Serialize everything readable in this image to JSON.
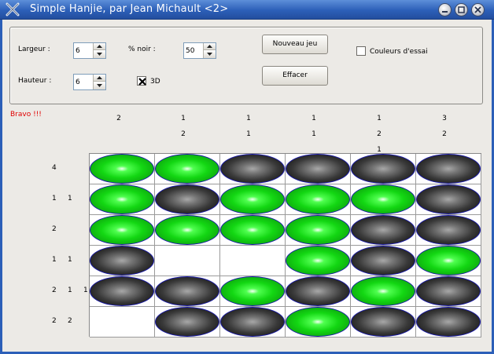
{
  "window": {
    "title": "Simple Hanjie, par Jean Michault <2>"
  },
  "controls": {
    "largeur_label": "Largeur :",
    "largeur_value": "6",
    "hauteur_label": "Hauteur :",
    "hauteur_value": "6",
    "noir_label": "% noir :",
    "noir_value": "50",
    "checkbox_3d_label": "3D",
    "checkbox_3d_checked": true,
    "nouveau_jeu_label": "Nouveau jeu",
    "effacer_label": "Effacer",
    "couleurs_label": "Couleurs d'essai",
    "couleurs_checked": false
  },
  "status": {
    "message": "Bravo !!!",
    "message_color": "#e00000"
  },
  "puzzle": {
    "column_clues": [
      [
        "2"
      ],
      [
        "1",
        "2"
      ],
      [
        "1",
        "1"
      ],
      [
        "1",
        "1"
      ],
      [
        "1",
        "2",
        "1"
      ],
      [
        "3",
        "2"
      ]
    ],
    "row_clues": [
      [
        "4"
      ],
      [
        "1",
        "1"
      ],
      [
        "2"
      ],
      [
        "1",
        "1"
      ],
      [
        "2",
        "1",
        "1"
      ],
      [
        "2",
        "2"
      ]
    ],
    "cells": [
      [
        "green",
        "green",
        "black",
        "black",
        "black",
        "black"
      ],
      [
        "green",
        "black",
        "green",
        "green",
        "green",
        "black"
      ],
      [
        "green",
        "green",
        "green",
        "green",
        "black",
        "black"
      ],
      [
        "black",
        "empty",
        "empty",
        "green",
        "black",
        "green"
      ],
      [
        "black",
        "black",
        "green",
        "black",
        "green",
        "black"
      ],
      [
        "empty",
        "black",
        "black",
        "green",
        "black",
        "black"
      ]
    ],
    "colors": {
      "green": "#13d713",
      "black": "#050505",
      "oval_border": "#1a1aa8"
    }
  }
}
